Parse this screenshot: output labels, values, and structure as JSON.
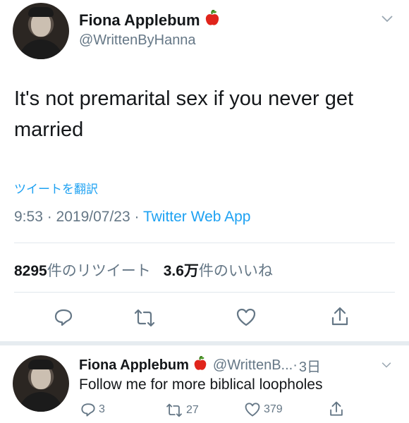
{
  "tweet": {
    "author_name": "Fiona Applebum",
    "author_handle": "@WrittenByHanna",
    "text_line1": "It's not premarital sex if you never get",
    "text_line2": "married",
    "translate_label": "ツイートを翻訳",
    "time": "9:53",
    "date": "2019/07/23",
    "source": "Twitter Web App",
    "retweet_count": "8295",
    "retweet_label": "件のリツイート",
    "like_count": "3.6万",
    "like_label": "件のいいね"
  },
  "reply": {
    "author_name": "Fiona Applebum",
    "author_handle": "@WrittenB...",
    "age": "3日",
    "text": "Follow me for more biblical loopholes",
    "reply_count": "3",
    "retweet_count": "27",
    "like_count": "379"
  },
  "colors": {
    "accent": "#1da1f2",
    "muted": "#657786",
    "text": "#14171a",
    "apple": "#e0241b"
  },
  "icons": [
    "apple-icon",
    "chevron-down-icon",
    "reply-icon",
    "retweet-icon",
    "like-icon",
    "share-icon"
  ]
}
